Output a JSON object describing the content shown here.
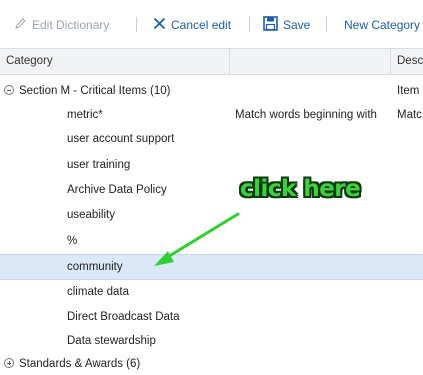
{
  "toolbar": {
    "edit_dictionary": "Edit Dictionary",
    "cancel_edit": "Cancel edit",
    "save": "Save",
    "new_category": "New Category"
  },
  "columns": [
    "Category",
    "",
    "Desc"
  ],
  "rows": [
    {
      "label": "Section M - Critical Items (10)",
      "col2": "",
      "col3": "Item"
    },
    {
      "label": "metric*",
      "col2": "Match words beginning with",
      "col3": "Matc"
    },
    {
      "label": "user account support",
      "col2": "",
      "col3": ""
    },
    {
      "label": "user training",
      "col2": "",
      "col3": ""
    },
    {
      "label": "Archive Data Policy",
      "col2": "",
      "col3": ""
    },
    {
      "label": "useability",
      "col2": "",
      "col3": ""
    },
    {
      "label": "%",
      "col2": "",
      "col3": ""
    },
    {
      "label": "community",
      "col2": "",
      "col3": ""
    },
    {
      "label": "climate data",
      "col2": "",
      "col3": ""
    },
    {
      "label": "Direct Broadcast Data",
      "col2": "",
      "col3": ""
    },
    {
      "label": "Data stewardship",
      "col2": "",
      "col3": ""
    },
    {
      "label": "Standards & Awards (6)",
      "col2": "",
      "col3": ""
    }
  ],
  "annotation": {
    "text": "click here"
  },
  "colors": {
    "toolbar_active": "#1f5fa8",
    "toolbar_disabled": "#9aa3ad",
    "selected_row": "#dbe8f7",
    "annotation_fill": "#3ed13e",
    "annotation_outline": "#0d3a0d",
    "arrow": "#2fcf2f"
  }
}
